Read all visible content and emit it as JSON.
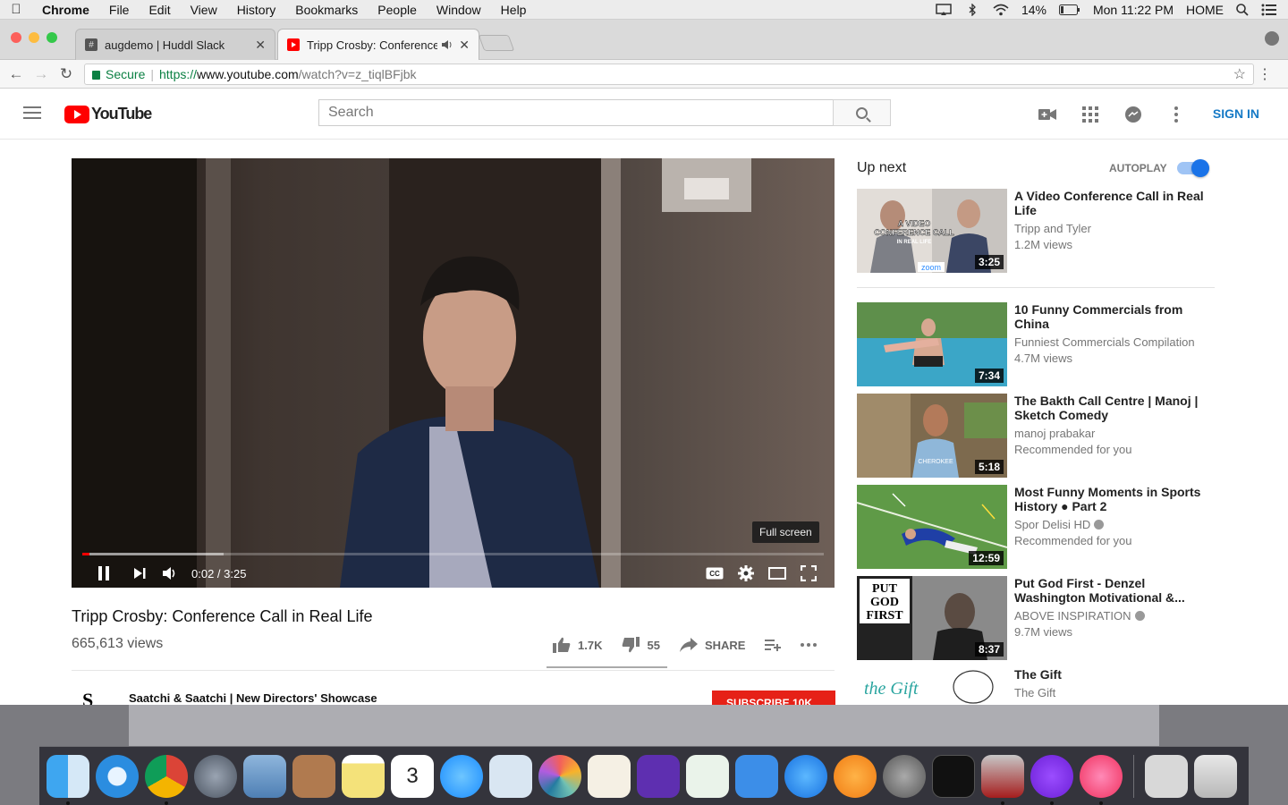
{
  "menubar": {
    "app": "Chrome",
    "items": [
      "File",
      "Edit",
      "View",
      "History",
      "Bookmarks",
      "People",
      "Window",
      "Help"
    ],
    "battery": "14%",
    "clock": "Mon 11:22 PM",
    "location": "HOME"
  },
  "browser": {
    "tabs": [
      {
        "title": "augdemo | Huddl Slack",
        "icon": "slack-icon"
      },
      {
        "title": "Tripp Crosby: Conference C",
        "icon": "youtube-icon"
      }
    ],
    "secure_label": "Secure",
    "url_scheme": "https://",
    "url_host": "www.youtube.com",
    "url_path": "/watch?v=z_tiqlBFjbk"
  },
  "youtube": {
    "logo_text": "YouTube",
    "search_placeholder": "Search",
    "signin_label": "SIGN IN",
    "player": {
      "tooltip": "Full screen",
      "time": "0:02 / 3:25",
      "progress_played_fraction": 0.01,
      "progress_loaded_fraction": 0.19
    },
    "video": {
      "title": "Tripp Crosby: Conference Call in Real Life",
      "views": "665,613 views",
      "likes": "1.7K",
      "dislikes": "55",
      "share_label": "SHARE"
    },
    "channel": {
      "logo_letter": "S",
      "name": "Saatchi & Saatchi | New Directors' Showcase",
      "subscribe_label": "SUBSCRIBE 10K"
    },
    "sidebar": {
      "upnext_label": "Up next",
      "autoplay_label": "AUTOPLAY",
      "autoplay_on": true,
      "items": [
        {
          "title": "A Video Conference Call in Real Life",
          "channel": "Tripp and Tyler",
          "meta": "1.2M views",
          "duration": "3:25",
          "verified": false
        },
        {
          "title": "10 Funny Commercials from China",
          "channel": "Funniest Commercials Compilation",
          "meta": "4.7M views",
          "duration": "7:34",
          "verified": false
        },
        {
          "title": "The Bakth Call Centre | Manoj | Sketch Comedy",
          "channel": "manoj prabakar",
          "meta": "Recommended for you",
          "duration": "5:18",
          "verified": false
        },
        {
          "title": "Most Funny Moments in Sports History ● Part 2",
          "channel": "Spor Delisi HD",
          "meta": "Recommended for you",
          "duration": "12:59",
          "verified": true
        },
        {
          "title": "Put God First - Denzel Washington Motivational &...",
          "channel": "ABOVE INSPIRATION",
          "meta": "9.7M views",
          "duration": "8:37",
          "verified": true
        },
        {
          "title": "The Gift",
          "channel": "The Gift",
          "meta": "",
          "duration": "",
          "verified": false
        }
      ],
      "thumb_text": {
        "conf_line1": "A VIDEO",
        "conf_line2": "CONFERENCE CALL",
        "conf_line3": "IN REAL LIFE",
        "conf_brand": "zoom",
        "god_line1": "PUT",
        "god_line2": "GOD",
        "god_line3": "FIRST",
        "gift_text": "the Gift"
      }
    }
  },
  "colors": {
    "youtube_red": "#ff0000",
    "link_blue": "#167ac6",
    "subscribe_red": "#e62117",
    "toggle_blue": "#1a73e8"
  }
}
